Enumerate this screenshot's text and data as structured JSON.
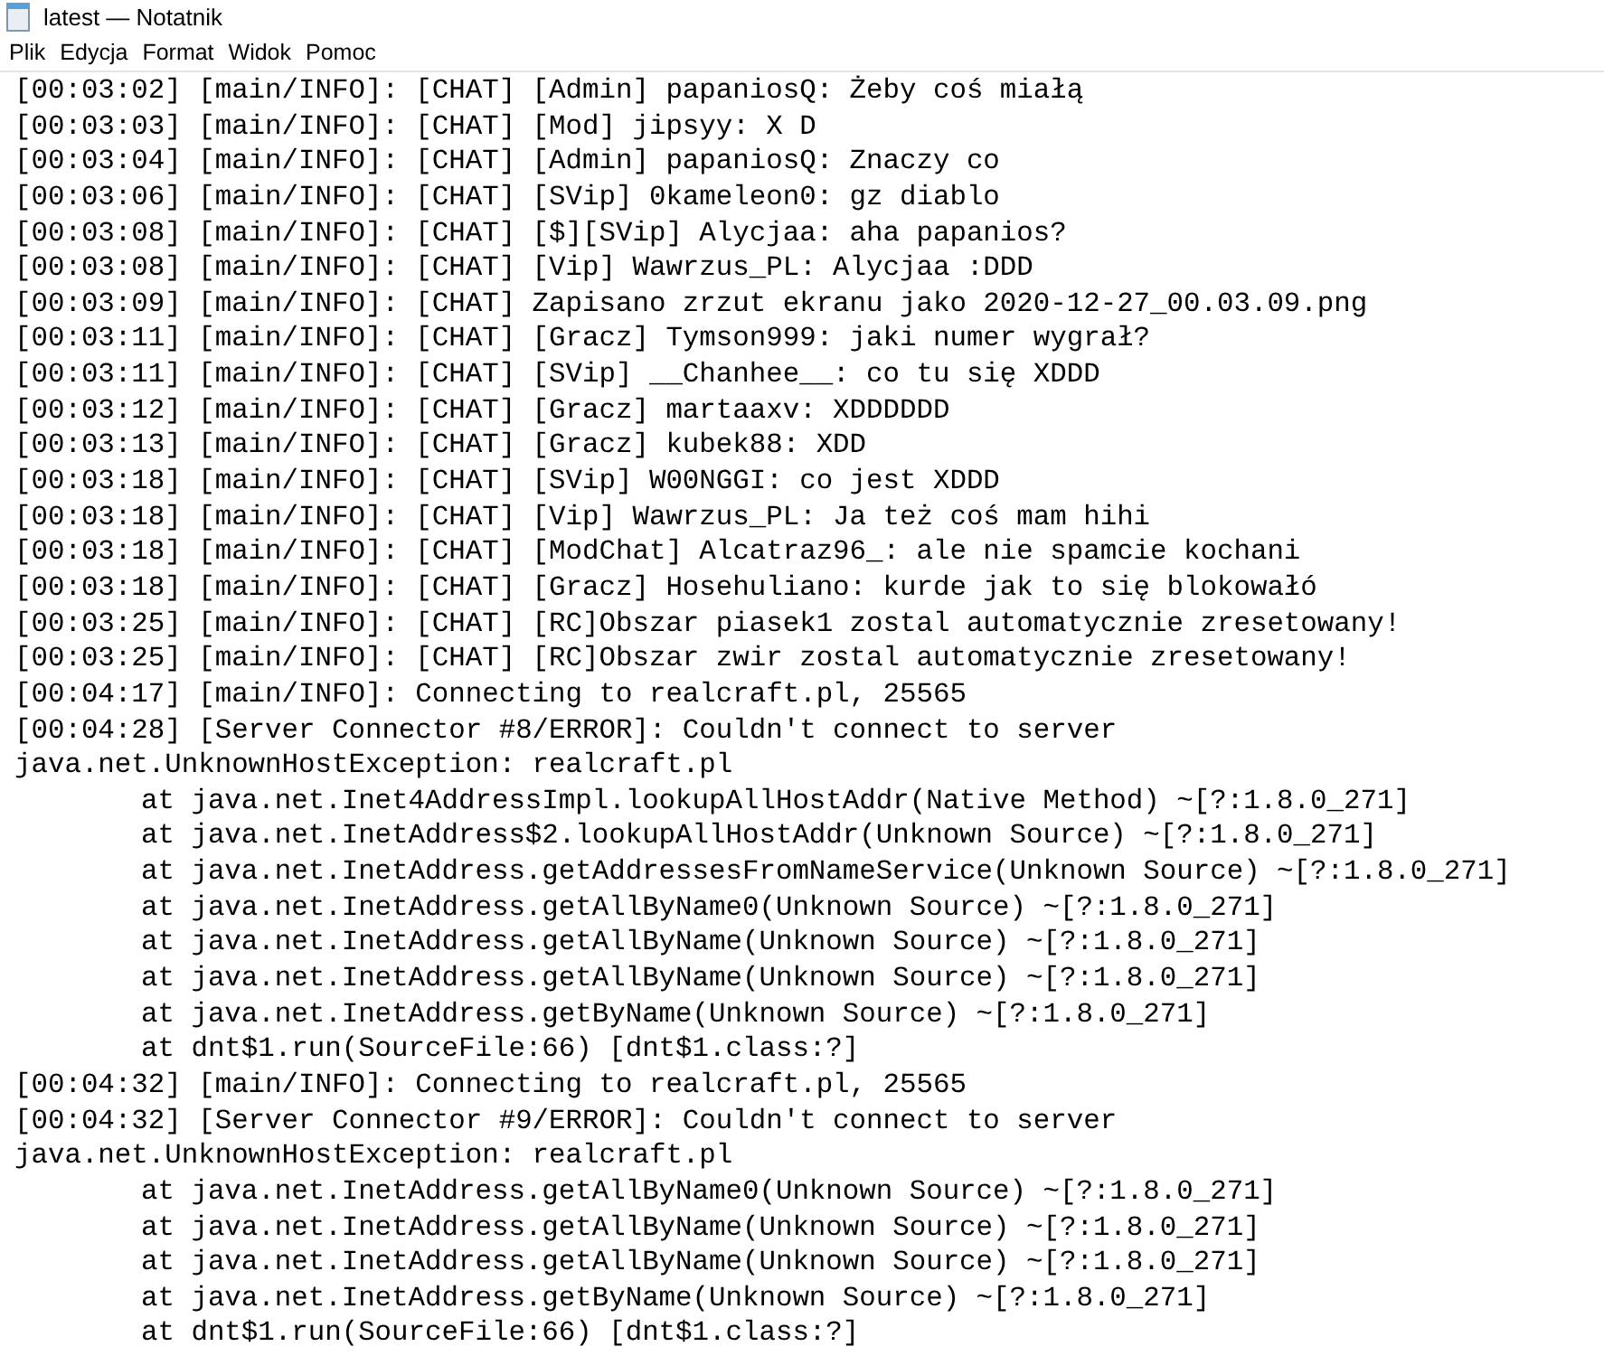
{
  "window": {
    "title": "latest — Notatnik"
  },
  "menu": [
    "Plik",
    "Edycja",
    "Format",
    "Widok",
    "Pomoc"
  ],
  "lines": [
    {
      "kind": "log",
      "text": "[00:03:02] [main/INFO]: [CHAT] [Admin] papaniosQ: Żeby coś miałą"
    },
    {
      "kind": "log",
      "text": "[00:03:03] [main/INFO]: [CHAT] [Mod] jipsyy: X D"
    },
    {
      "kind": "log",
      "text": "[00:03:04] [main/INFO]: [CHAT] [Admin] papaniosQ: Znaczy co"
    },
    {
      "kind": "log",
      "text": "[00:03:06] [main/INFO]: [CHAT] [SVip] 0kameleon0: gz diablo"
    },
    {
      "kind": "log",
      "text": "[00:03:08] [main/INFO]: [CHAT] [$][SVip] Alycjaa: aha papanios?"
    },
    {
      "kind": "log",
      "text": "[00:03:08] [main/INFO]: [CHAT] [Vip] Wawrzus_PL: Alycjaa :DDD"
    },
    {
      "kind": "log",
      "text": "[00:03:09] [main/INFO]: [CHAT] Zapisano zrzut ekranu jako 2020-12-27_00.03.09.png"
    },
    {
      "kind": "log",
      "text": "[00:03:11] [main/INFO]: [CHAT] [Gracz] Tymson999: jaki numer wygrał?"
    },
    {
      "kind": "log",
      "text": "[00:03:11] [main/INFO]: [CHAT] [SVip] __Chanhee__: co tu się XDDD"
    },
    {
      "kind": "log",
      "text": "[00:03:12] [main/INFO]: [CHAT] [Gracz] martaaxv: XDDDDDD"
    },
    {
      "kind": "log",
      "text": "[00:03:13] [main/INFO]: [CHAT] [Gracz] kubek88: XDD"
    },
    {
      "kind": "log",
      "text": "[00:03:18] [main/INFO]: [CHAT] [SVip] W00NGGI: co jest XDDD"
    },
    {
      "kind": "log",
      "text": "[00:03:18] [main/INFO]: [CHAT] [Vip] Wawrzus_PL: Ja też coś mam hihi"
    },
    {
      "kind": "log",
      "text": "[00:03:18] [main/INFO]: [CHAT] [ModChat] Alcatraz96_: ale nie spamcie kochani"
    },
    {
      "kind": "log",
      "text": "[00:03:18] [main/INFO]: [CHAT] [Gracz] Hosehuliano: kurde jak to się blokowałó"
    },
    {
      "kind": "log",
      "text": "[00:03:25] [main/INFO]: [CHAT] [RC]Obszar piasek1 zostal automatycznie zresetowany!"
    },
    {
      "kind": "log",
      "text": "[00:03:25] [main/INFO]: [CHAT] [RC]Obszar zwir zostal automatycznie zresetowany!"
    },
    {
      "kind": "log",
      "text": "[00:04:17] [main/INFO]: Connecting to realcraft.pl, 25565"
    },
    {
      "kind": "log",
      "text": "[00:04:28] [Server Connector #8/ERROR]: Couldn't connect to server"
    },
    {
      "kind": "log",
      "text": "java.net.UnknownHostException: realcraft.pl"
    },
    {
      "kind": "trace",
      "text": "at java.net.Inet4AddressImpl.lookupAllHostAddr(Native Method) ~[?:1.8.0_271]"
    },
    {
      "kind": "trace",
      "text": "at java.net.InetAddress$2.lookupAllHostAddr(Unknown Source) ~[?:1.8.0_271]"
    },
    {
      "kind": "trace",
      "text": "at java.net.InetAddress.getAddressesFromNameService(Unknown Source) ~[?:1.8.0_271]"
    },
    {
      "kind": "trace",
      "text": "at java.net.InetAddress.getAllByName0(Unknown Source) ~[?:1.8.0_271]"
    },
    {
      "kind": "trace",
      "text": "at java.net.InetAddress.getAllByName(Unknown Source) ~[?:1.8.0_271]"
    },
    {
      "kind": "trace",
      "text": "at java.net.InetAddress.getAllByName(Unknown Source) ~[?:1.8.0_271]"
    },
    {
      "kind": "trace",
      "text": "at java.net.InetAddress.getByName(Unknown Source) ~[?:1.8.0_271]"
    },
    {
      "kind": "trace",
      "text": "at dnt$1.run(SourceFile:66) [dnt$1.class:?]"
    },
    {
      "kind": "log",
      "text": "[00:04:32] [main/INFO]: Connecting to realcraft.pl, 25565"
    },
    {
      "kind": "log",
      "text": "[00:04:32] [Server Connector #9/ERROR]: Couldn't connect to server"
    },
    {
      "kind": "log",
      "text": "java.net.UnknownHostException: realcraft.pl"
    },
    {
      "kind": "trace",
      "text": "at java.net.InetAddress.getAllByName0(Unknown Source) ~[?:1.8.0_271]"
    },
    {
      "kind": "trace",
      "text": "at java.net.InetAddress.getAllByName(Unknown Source) ~[?:1.8.0_271]"
    },
    {
      "kind": "trace",
      "text": "at java.net.InetAddress.getAllByName(Unknown Source) ~[?:1.8.0_271]"
    },
    {
      "kind": "trace",
      "text": "at java.net.InetAddress.getByName(Unknown Source) ~[?:1.8.0_271]"
    },
    {
      "kind": "trace",
      "text": "at dnt$1.run(SourceFile:66) [dnt$1.class:?]"
    }
  ]
}
